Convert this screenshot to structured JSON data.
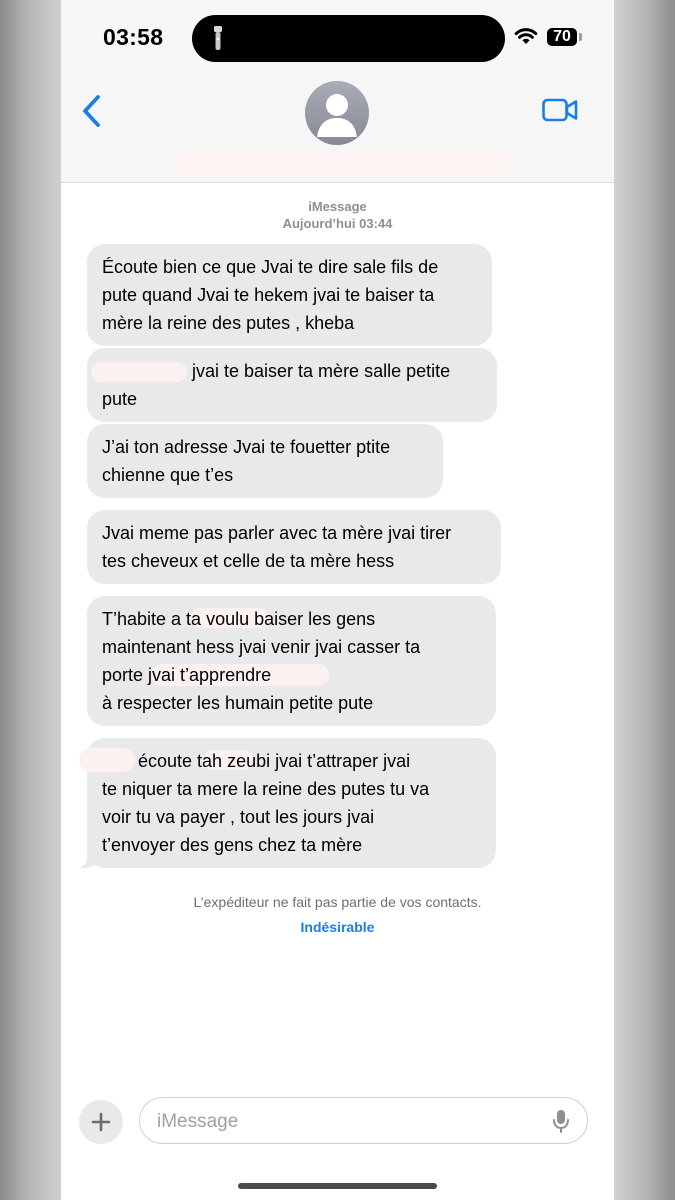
{
  "status_bar": {
    "time": "03:58",
    "battery": "70"
  },
  "header": {
    "contact_name": "",
    "back_icon": "chevron-left-icon",
    "video_icon": "video-camera-icon",
    "avatar_icon": "person-silhouette-icon"
  },
  "thread": {
    "service": "iMessage",
    "timestamp": "Aujourd’hui 03:44"
  },
  "messages": [
    {
      "text": "Écoute bien ce que Jvai te dire sale fils de\npute quand Jvai te hekem jvai te baiser ta\nmère la reine des putes , kheba"
    },
    {
      "text": "jvai te baiser ta mère salle petite\npute"
    },
    {
      "text": "J’ai ton adresse Jvai te fouetter ptite\nchienne que t’es"
    },
    {
      "text": "Jvai meme pas parler avec ta mère jvai tirer\ntes cheveux et celle de ta mère hess"
    },
    {
      "text": "T’habite a            ta voulu baiser les gens\nmaintenant hess jvai venir jvai casser ta\nporte                                jvai t’apprendre\nà respecter les humain petite pute"
    },
    {
      "text": "écoute          tah zeubi jvai t’attraper jvai\nte niquer ta mere la reine des putes tu va\nvoir tu va payer , tout les jours jvai\nt’envoyer des gens chez ta mère"
    }
  ],
  "notice": {
    "text": "L’expéditeur ne fait pas partie de vos contacts.",
    "junk_label": "Indésirable"
  },
  "compose": {
    "placeholder": "iMessage",
    "plus_icon": "plus-icon",
    "mic_icon": "microphone-icon"
  },
  "colors": {
    "accent": "#1a7ee6",
    "bubble": "#e9e9eb",
    "header_bg": "#f6f6f6"
  }
}
